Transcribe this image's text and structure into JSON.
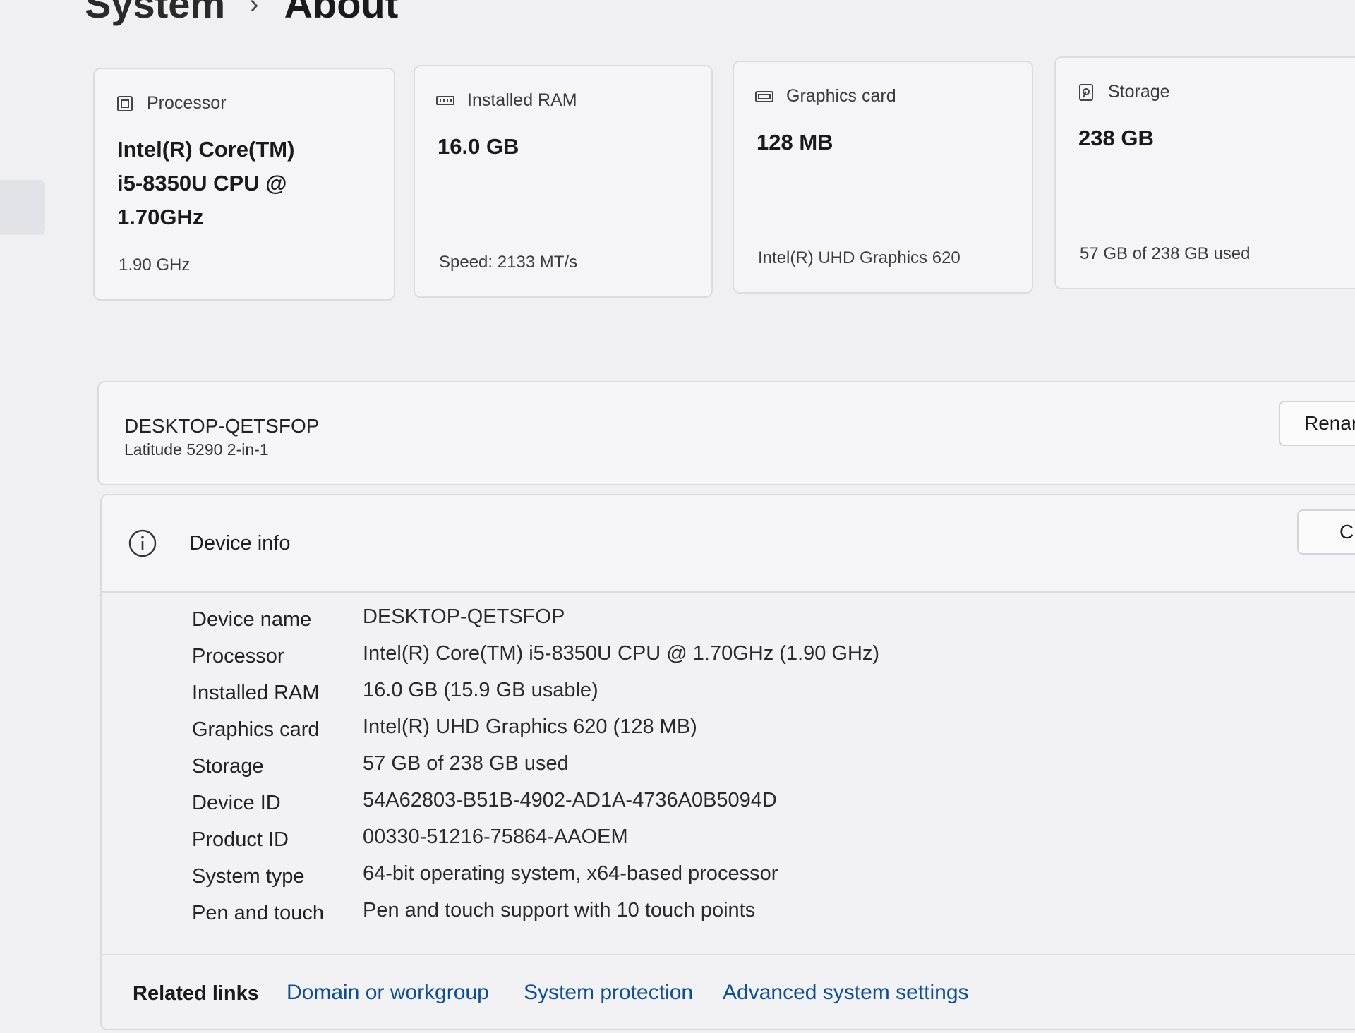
{
  "breadcrumb": {
    "parent": "System",
    "separator": "›",
    "current": "About"
  },
  "cards": [
    {
      "icon": "processor-icon",
      "title": "Processor",
      "value_lines": [
        "Intel(R) Core(TM)",
        "i5-8350U CPU @",
        "1.70GHz"
      ],
      "sub": "1.90 GHz"
    },
    {
      "icon": "ram-icon",
      "title": "Installed RAM",
      "value_lines": [
        "16.0 GB"
      ],
      "sub": "Speed: 2133 MT/s"
    },
    {
      "icon": "graphics-card-icon",
      "title": "Graphics card",
      "value_lines": [
        "128 MB"
      ],
      "sub": "Intel(R) UHD Graphics 620"
    },
    {
      "icon": "storage-icon",
      "title": "Storage",
      "value_lines": [
        "238 GB"
      ],
      "sub": "57 GB of 238 GB used"
    }
  ],
  "pc": {
    "name": "DESKTOP-QETSFOP",
    "model": "Latitude 5290 2-in-1",
    "rename_label": "Renar"
  },
  "device_info": {
    "title": "Device info",
    "copy_label": "C",
    "rows": [
      {
        "label": "Device name",
        "value": "DESKTOP-QETSFOP"
      },
      {
        "label": "Processor",
        "value": "Intel(R) Core(TM) i5-8350U CPU @ 1.70GHz (1.90 GHz)"
      },
      {
        "label": "Installed RAM",
        "value": "16.0 GB (15.9 GB usable)"
      },
      {
        "label": "Graphics card",
        "value": "Intel(R) UHD Graphics 620 (128 MB)"
      },
      {
        "label": "Storage",
        "value": "57 GB of 238 GB used"
      },
      {
        "label": "Device ID",
        "value": "54A62803-B51B-4902-AD1A-4736A0B5094D"
      },
      {
        "label": "Product ID",
        "value": "00330-51216-75864-AAOEM"
      },
      {
        "label": "System type",
        "value": "64-bit operating system, x64-based processor"
      },
      {
        "label": "Pen and touch",
        "value": "Pen and touch support with 10 touch points"
      }
    ]
  },
  "related_links": {
    "label": "Related links",
    "links": [
      "Domain or workgroup",
      "System protection",
      "Advanced system settings"
    ]
  },
  "colors": {
    "background": "#f0f0f2",
    "card": "#f5f5f7",
    "link": "#0b4f98"
  }
}
